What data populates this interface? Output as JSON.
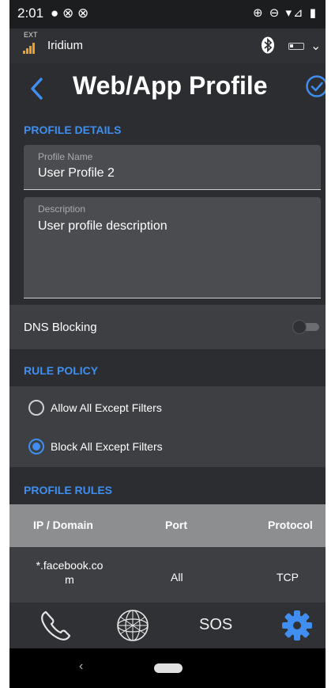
{
  "status_bar": {
    "time": "2:01",
    "left_icons": "● ⊗ ⊗",
    "right_icons": "⊕ ⊖ ▾⊿ ▮"
  },
  "carrier_bar": {
    "ext_label": "EXT",
    "network_name": "Iridium",
    "signal_color": "#f0a020"
  },
  "header": {
    "back_icon": "chevron-left-icon",
    "title": "Web/App Profile",
    "confirm_icon": "check-circle-icon",
    "accent_color": "#3f8ef0"
  },
  "profile_details": {
    "section_title": "PROFILE DETAILS",
    "name_label": "Profile Name",
    "name_value": "User Profile 2",
    "description_label": "Description",
    "description_value": "User profile description"
  },
  "dns_blocking": {
    "label": "DNS Blocking",
    "enabled": false
  },
  "rule_policy": {
    "section_title": "RULE POLICY",
    "options": [
      {
        "label": "Allow All Except Filters",
        "selected": false
      },
      {
        "label": "Block All Except Filters",
        "selected": true
      }
    ]
  },
  "profile_rules": {
    "section_title": "PROFILE RULES",
    "columns": [
      "IP / Domain",
      "Port",
      "Protocol"
    ],
    "rows": [
      {
        "domain_line1": "*.facebook.co",
        "domain_line2": "m",
        "port": "All",
        "protocol": "TCP"
      }
    ]
  },
  "tab_bar": {
    "tabs": [
      "phone-icon",
      "globe-icon",
      "SOS",
      "gear-icon"
    ],
    "sos_label": "SOS",
    "active_color": "#3f8ef0"
  },
  "nav_bar": {
    "back_glyph": "‹"
  }
}
